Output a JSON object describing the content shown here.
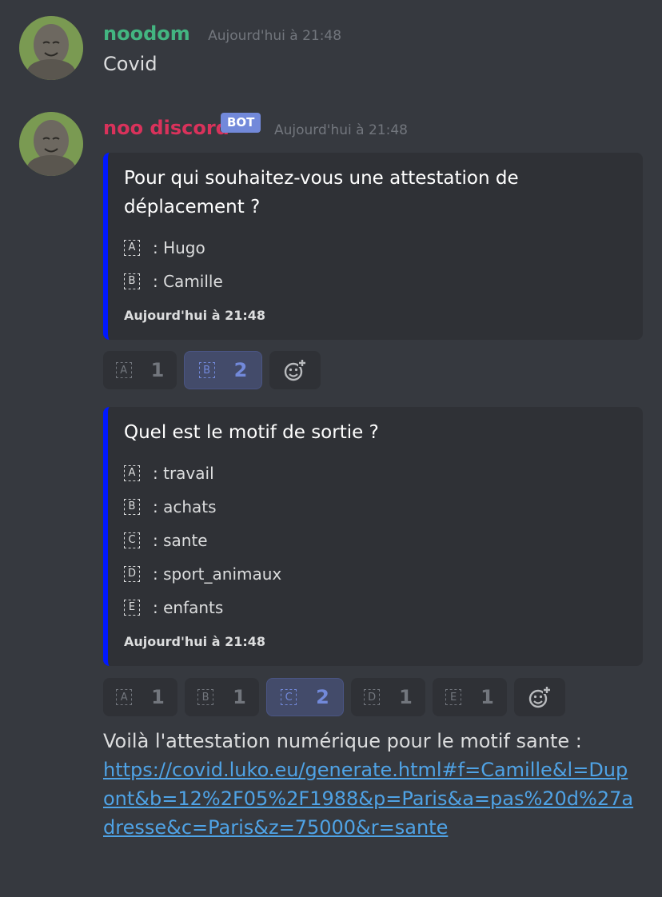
{
  "message1": {
    "username": "noodom",
    "timestamp": "Aujourd'hui à 21:48",
    "text": "Covid",
    "username_color": "#43b581"
  },
  "message2": {
    "username": "noo discord",
    "badge": "BOT",
    "timestamp": "Aujourd'hui à 21:48",
    "username_color": "#d9325b",
    "embed1": {
      "title": "Pour qui souhaitez-vous une attestation de déplacement ?",
      "options": [
        {
          "icon": "A",
          "text": ": Hugo"
        },
        {
          "icon": "B",
          "text": ": Camille"
        }
      ],
      "footer": "Aujourd'hui à 21:48"
    },
    "reactions1": [
      {
        "icon": "A",
        "count": "1",
        "active": false
      },
      {
        "icon": "B",
        "count": "2",
        "active": true
      }
    ],
    "embed2": {
      "title": "Quel est le motif de sortie ?",
      "options": [
        {
          "icon": "A",
          "text": ": travail"
        },
        {
          "icon": "B",
          "text": ": achats"
        },
        {
          "icon": "C",
          "text": ": sante"
        },
        {
          "icon": "D",
          "text": ": sport_animaux"
        },
        {
          "icon": "E",
          "text": ": enfants"
        }
      ],
      "footer": "Aujourd'hui à 21:48"
    },
    "reactions2": [
      {
        "icon": "A",
        "count": "1",
        "active": false
      },
      {
        "icon": "B",
        "count": "1",
        "active": false
      },
      {
        "icon": "C",
        "count": "2",
        "active": true
      },
      {
        "icon": "D",
        "count": "1",
        "active": false
      },
      {
        "icon": "E",
        "count": "1",
        "active": false
      }
    ],
    "result_text": "Voilà l'attestation numérique pour le motif sante :",
    "result_link": "https://covid.luko.eu/generate.html#f=Camille&l=Dupont&b=12%2F05%2F1988&p=Paris&a=pas%20d%27adresse&c=Paris&z=75000&r=sante"
  },
  "colors": {
    "background": "#36393f",
    "embed_bg": "#2f3136",
    "embed_border": "#0018ff",
    "link": "#4fa3e6",
    "bot_badge": "#7289da"
  }
}
